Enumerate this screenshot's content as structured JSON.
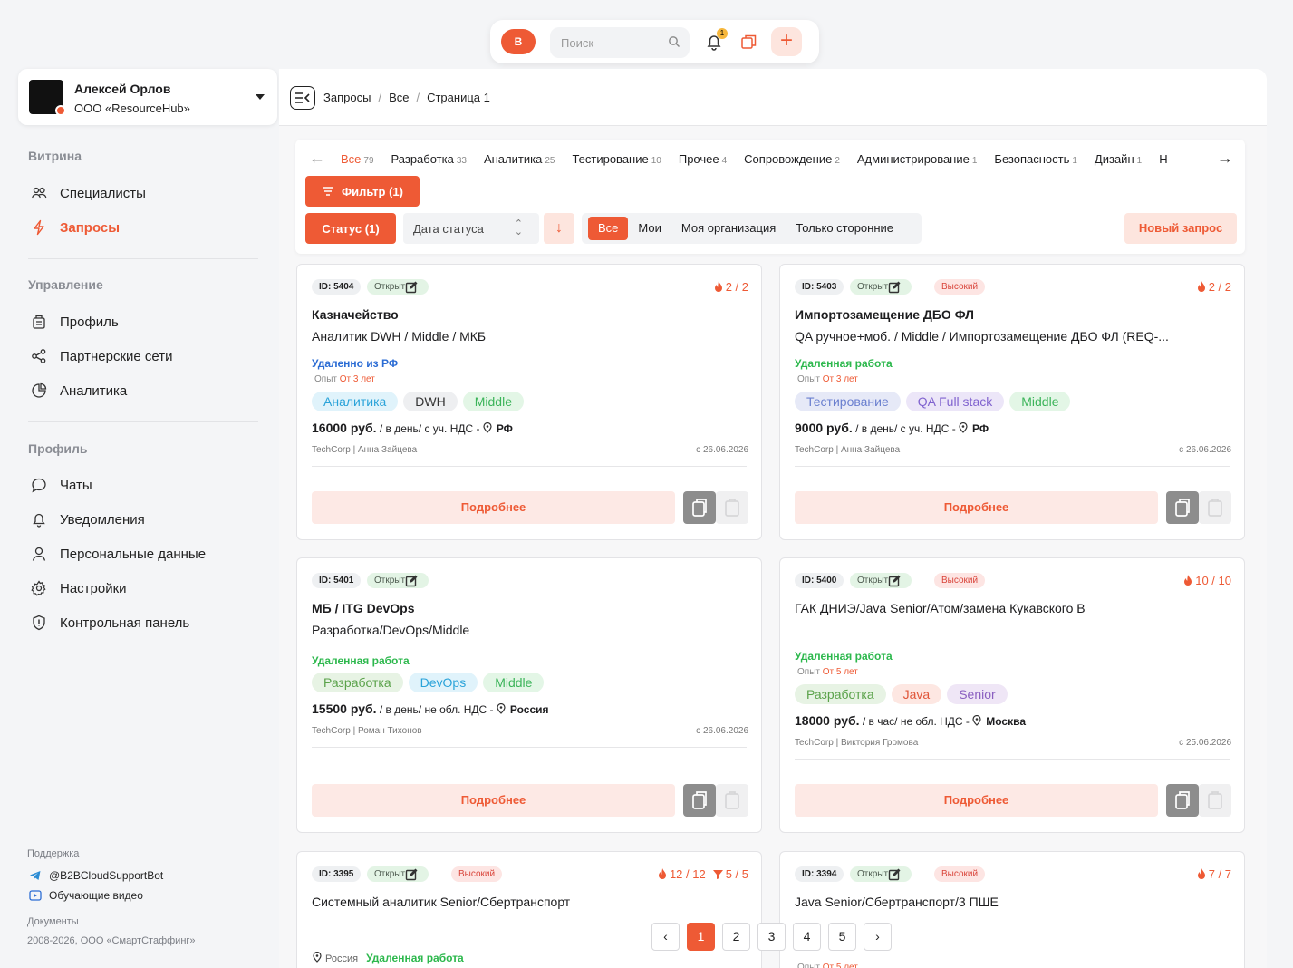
{
  "topbar": {
    "logo": "B",
    "search_placeholder": "Поиск",
    "notif_count": "1"
  },
  "user": {
    "name": "Алексей Орлов",
    "org": "ООО «ResourceHub»"
  },
  "sidebar": {
    "sections": [
      {
        "title": "Витрина",
        "items": [
          {
            "label": "Специалисты",
            "icon": "people-icon"
          },
          {
            "label": "Запросы",
            "icon": "lightning-icon",
            "active": true
          }
        ]
      },
      {
        "title": "Управление",
        "items": [
          {
            "label": "Профиль",
            "icon": "building-icon"
          },
          {
            "label": "Партнерские сети",
            "icon": "share-icon"
          },
          {
            "label": "Аналитика",
            "icon": "chart-icon"
          }
        ]
      },
      {
        "title": "Профиль",
        "items": [
          {
            "label": "Чаты",
            "icon": "chat-icon"
          },
          {
            "label": "Уведомления",
            "icon": "bell-icon"
          },
          {
            "label": "Персональные данные",
            "icon": "user-icon"
          },
          {
            "label": "Настройки",
            "icon": "gear-icon"
          },
          {
            "label": "Контрольная панель",
            "icon": "shield-icon"
          }
        ]
      }
    ],
    "footer": {
      "support_title": "Поддержка",
      "bot": "@B2BCloudSupportBot",
      "videos": "Обучающие видео",
      "docs": "Документы",
      "copyright": "2008-2026, ООО «СмартСтаффинг»"
    }
  },
  "breadcrumbs": [
    "Запросы",
    "Все",
    "Страница 1"
  ],
  "tabs": [
    {
      "label": "Все",
      "count": "79",
      "active": true
    },
    {
      "label": "Разработка",
      "count": "33"
    },
    {
      "label": "Аналитика",
      "count": "25"
    },
    {
      "label": "Тестирование",
      "count": "10"
    },
    {
      "label": "Прочее",
      "count": "4"
    },
    {
      "label": "Сопровождение",
      "count": "2"
    },
    {
      "label": "Администрирование",
      "count": "1"
    },
    {
      "label": "Безопасность",
      "count": "1"
    },
    {
      "label": "Дизайн",
      "count": "1"
    },
    {
      "label": "Н",
      "count": ""
    }
  ],
  "filters": {
    "filter_label": "Фильтр (1)",
    "status_label": "Статус (1)",
    "date_label": "Дата статуса",
    "segments": [
      "Все",
      "Мои",
      "Моя организация",
      "Только сторонние"
    ],
    "new_request": "Новый запрос"
  },
  "cards": [
    {
      "id": "ID: 5404",
      "status": "Открыт",
      "priority": "",
      "counter": "2 / 2",
      "counter2": "",
      "title": "Казначейство",
      "subtitle": "Аналитик DWH / Middle / МКБ",
      "location": "Удаленно из РФ",
      "location_color": "#2b6cd4",
      "exp_label": "Опыт",
      "exp": "От 3 лет",
      "chips": [
        {
          "t": "Аналитика",
          "bg": "#e0f3fb",
          "fg": "#2aa3d9"
        },
        {
          "t": "DWH",
          "bg": "#eeeff1",
          "fg": "#333"
        },
        {
          "t": "Middle",
          "bg": "#e3f6e6",
          "fg": "#3cb45a"
        }
      ],
      "price": "16000 руб.",
      "price_terms": " / в день/ с уч. НДС - ",
      "country": "РФ",
      "company": "TechCorp",
      "person": "Анна Зайцева",
      "date": "с 26.06.2026",
      "more": "Подробнее"
    },
    {
      "id": "ID: 5403",
      "status": "Открыт",
      "priority": "Высокий",
      "counter": "2 / 2",
      "counter2": "",
      "title": "Импортозамещение ДБО ФЛ",
      "subtitle": "QA ручное+моб. / Middle / Импортозамещение ДБО ФЛ (REQ-...",
      "location": "Удаленная работа",
      "location_color": "#2db84d",
      "exp_label": "Опыт",
      "exp": "От 3 лет",
      "chips": [
        {
          "t": "Тестирование",
          "bg": "#e6e9f7",
          "fg": "#6a7fcf"
        },
        {
          "t": "QA Full stack",
          "bg": "#ece6f8",
          "fg": "#8063cf"
        },
        {
          "t": "Middle",
          "bg": "#e3f6e6",
          "fg": "#3cb45a"
        }
      ],
      "price": "9000 руб.",
      "price_terms": " / в день/ с уч. НДС - ",
      "country": "РФ",
      "company": "TechCorp",
      "person": "Анна Зайцева",
      "date": "с 26.06.2026",
      "more": "Подробнее"
    },
    {
      "id": "ID: 5401",
      "status": "Открыт",
      "priority": "",
      "counter": "",
      "counter2": "",
      "title": "МБ / ITG DevOps",
      "subtitle": "Разработка/DevOps/Middle",
      "location": "Удаленная работа",
      "location_color": "#2db84d",
      "exp_label": "",
      "exp": "",
      "chips": [
        {
          "t": "Разработка",
          "bg": "#e7f3e4",
          "fg": "#5aa24a"
        },
        {
          "t": "DevOps",
          "bg": "#e0f3fb",
          "fg": "#2aa3d9"
        },
        {
          "t": "Middle",
          "bg": "#e3f6e6",
          "fg": "#3cb45a"
        }
      ],
      "price": "15500 руб.",
      "price_terms": " / в день/ не обл. НДС - ",
      "country": "Россия",
      "company": "TechCorp",
      "person": "Роман Тихонов",
      "date": "с 26.06.2026",
      "more": "Подробнее"
    },
    {
      "id": "ID: 5400",
      "status": "Открыт",
      "priority": "Высокий",
      "counter": "10 / 10",
      "counter2": "",
      "title": "",
      "subtitle": "ГАК ДНИЭ/Java Senior/Атом/замена Кукавского В",
      "location": "Удаленная работа",
      "location_color": "#2db84d",
      "exp_label": "Опыт",
      "exp": "От 5 лет",
      "chips": [
        {
          "t": "Разработка",
          "bg": "#e7f3e4",
          "fg": "#5aa24a"
        },
        {
          "t": "Java",
          "bg": "#fde7e2",
          "fg": "#e0563a"
        },
        {
          "t": "Senior",
          "bg": "#efe6f6",
          "fg": "#8a5fc0"
        }
      ],
      "price": "18000 руб.",
      "price_terms": " / в час/ не обл. НДС - ",
      "country": "Москва",
      "company": "TechCorp",
      "person": "Виктория Громова",
      "date": "с 25.06.2026",
      "more": "Подробнее"
    },
    {
      "id": "ID: 3395",
      "status": "Открыт",
      "priority": "Высокий",
      "counter": "12 / 12",
      "counter2": "5 / 5",
      "title": "",
      "subtitle": "Системный аналитик Senior/Сбертранспорт",
      "location": "Удаленная работа",
      "location_color": "#2db84d",
      "country_small": "Россия"
    },
    {
      "id": "ID: 3394",
      "status": "Открыт",
      "priority": "Высокий",
      "counter": "7 / 7",
      "counter2": "",
      "title": "",
      "subtitle": "Java Senior/Сбертранспорт/3 ПШЕ",
      "exp_label": "Опыт",
      "exp": "От 5 лет"
    }
  ],
  "pagination": {
    "pages": [
      "1",
      "2",
      "3",
      "4",
      "5"
    ],
    "current": "1"
  }
}
